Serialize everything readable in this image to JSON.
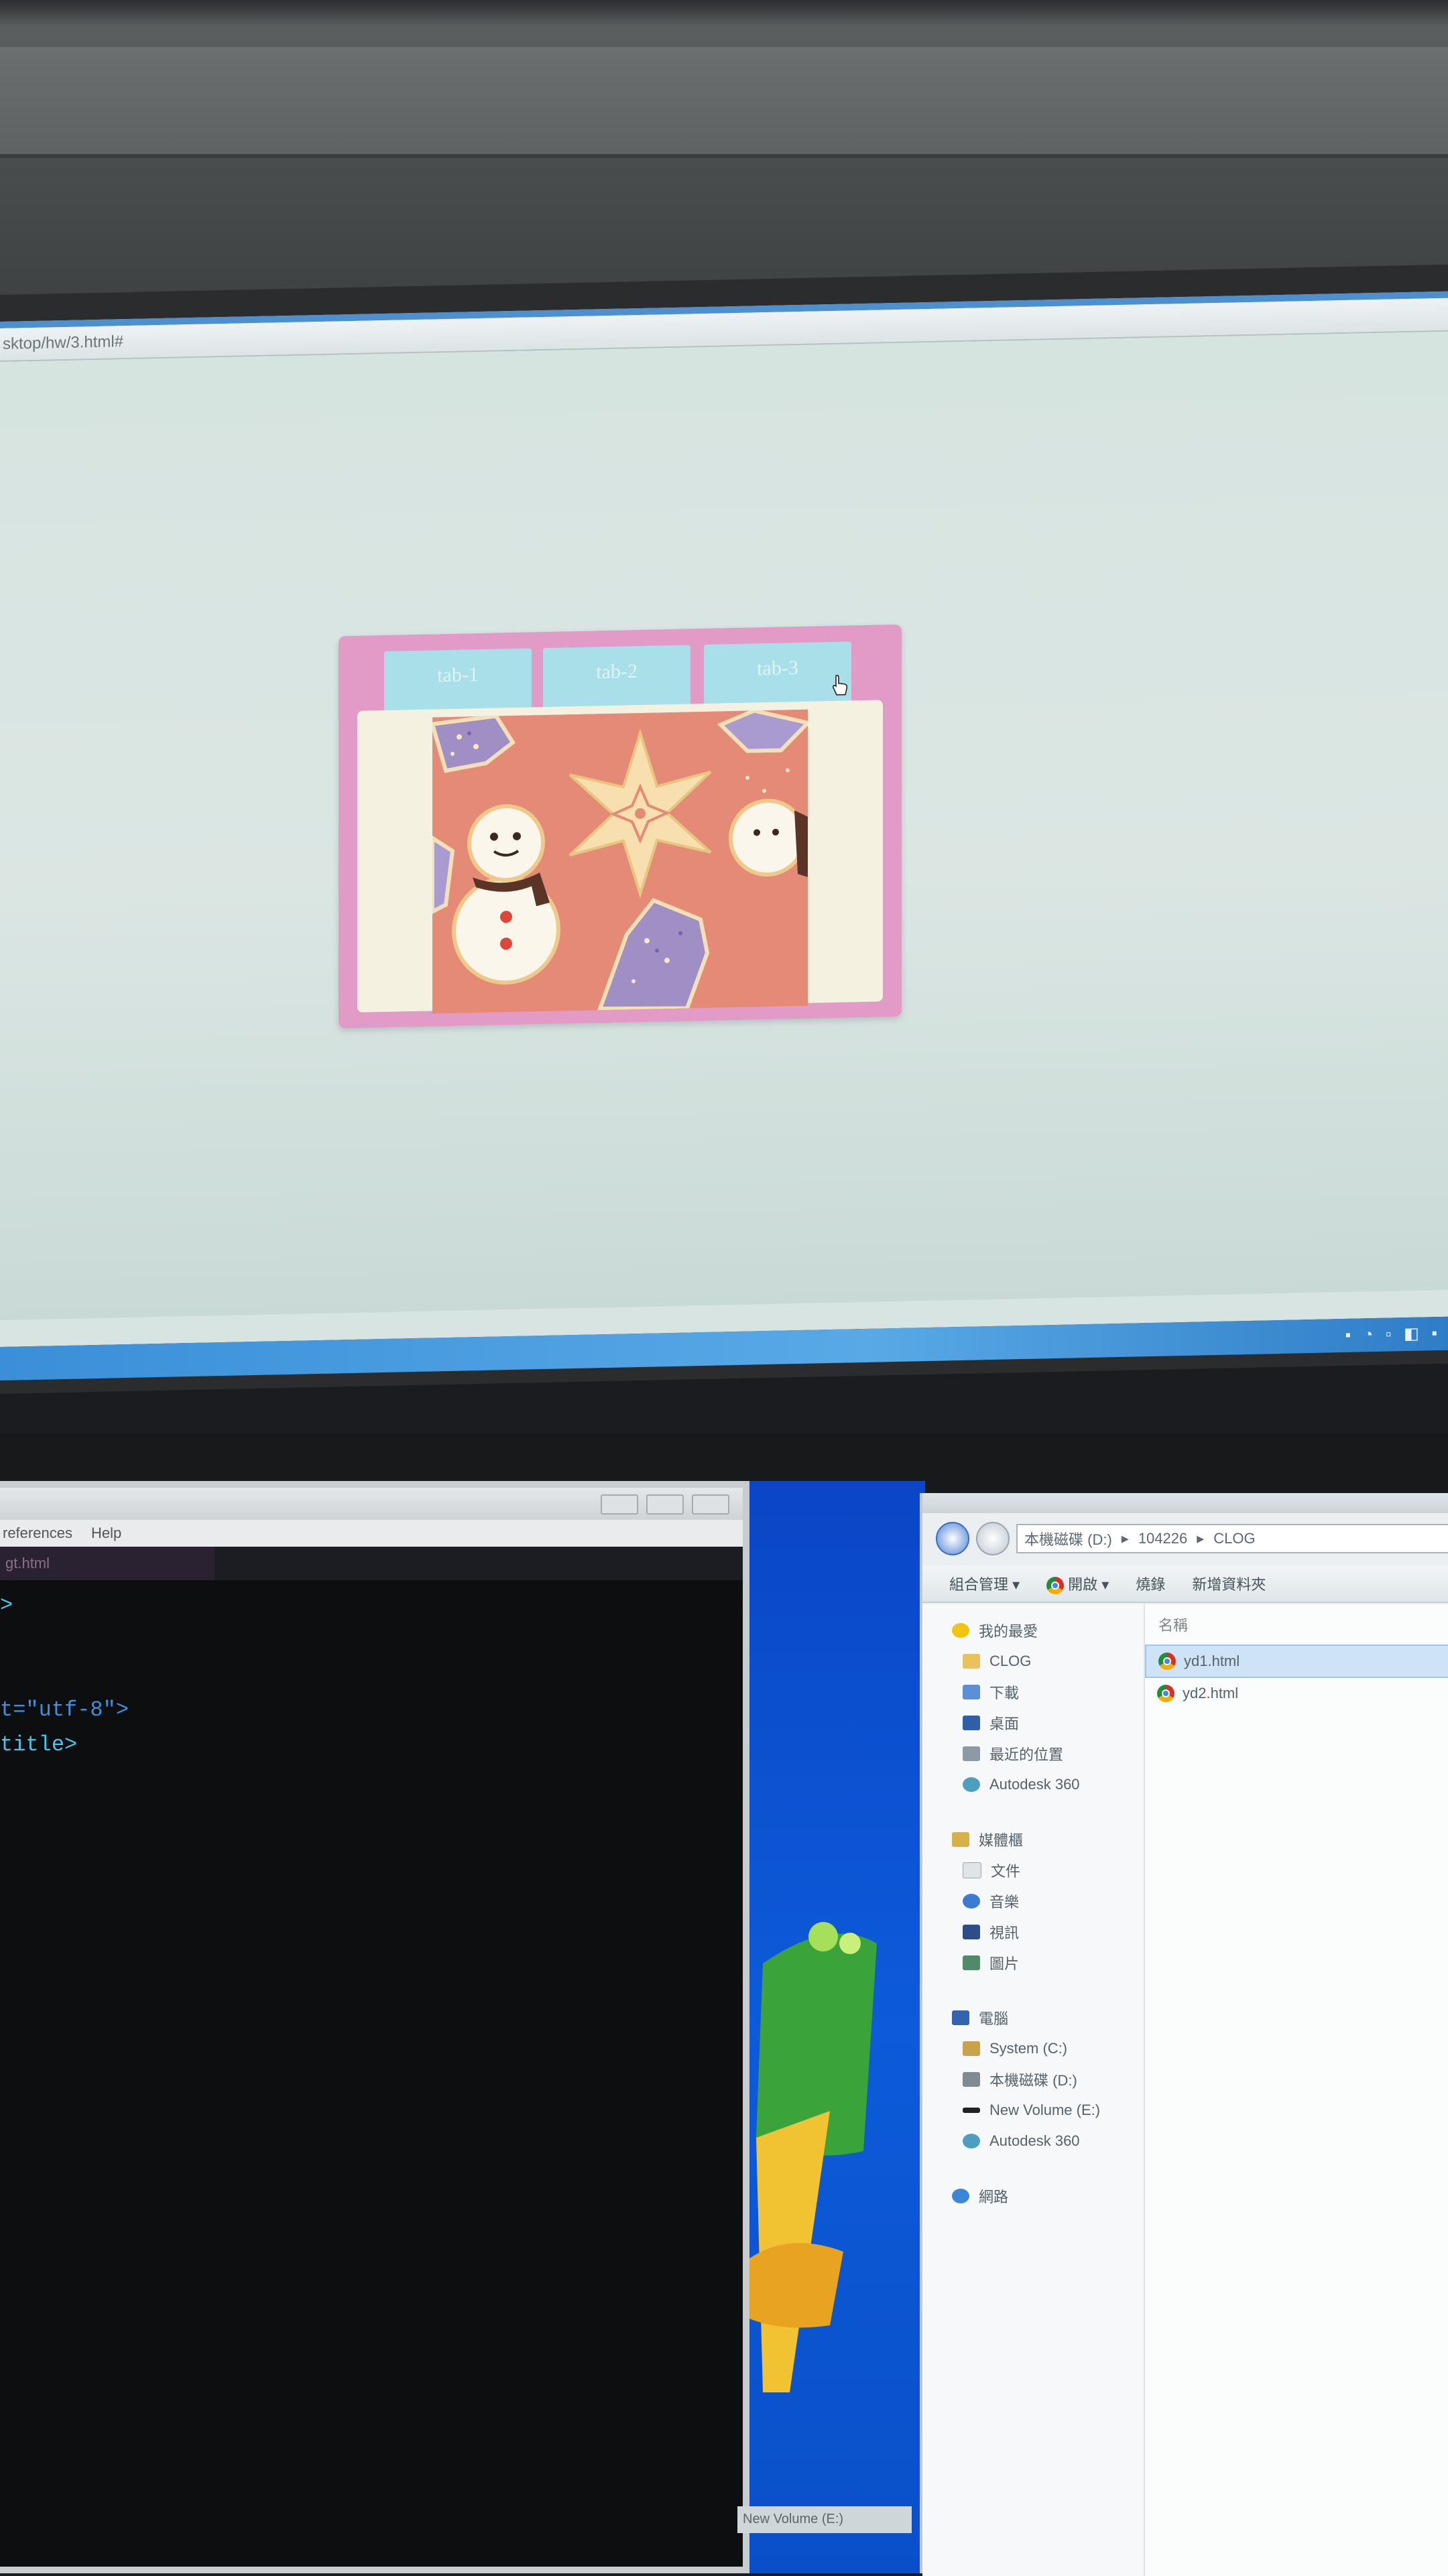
{
  "browser": {
    "address": "sktop/hw/3.html#",
    "tabs": [
      {
        "label": "tab-1"
      },
      {
        "label": "tab-2"
      },
      {
        "label": "tab-3"
      }
    ],
    "active_content": "cookie-illustration",
    "colors": {
      "widget_frame": "#e29bc7",
      "tab_bg": "#a8dfe8",
      "panel_bg": "#f4f1e1",
      "taskbar": "#3a8fd8"
    }
  },
  "editor": {
    "menu": [
      "references",
      "Help"
    ],
    "tab_label": "gt.html",
    "code_lines": [
      ">",
      "",
      "",
      "t=\"utf-8\">",
      "title>"
    ]
  },
  "explorer": {
    "address_parts": [
      "本機磁碟 (D:)",
      "104226",
      "CLOG"
    ],
    "toolbar": [
      "組合管理 ▾",
      "開啟 ▾",
      "燒錄",
      "新增資料夾"
    ],
    "nav_groups": [
      {
        "title": "我的最愛",
        "items": [
          "CLOG",
          "下載",
          "桌面",
          "最近的位置",
          "Autodesk 360"
        ]
      },
      {
        "title": "媒體櫃",
        "items": [
          "文件",
          "音樂",
          "視訊",
          "圖片"
        ]
      },
      {
        "title": "電腦",
        "items": [
          "System (C:)",
          "本機磁碟 (D:)",
          "New Volume (E:)",
          "Autodesk 360"
        ]
      },
      {
        "title": "網路",
        "items": []
      }
    ],
    "files_header": "名稱",
    "files": [
      {
        "name": "yd1.html",
        "selected": true
      },
      {
        "name": "yd2.html",
        "selected": false
      }
    ],
    "status": "New Volume (E:)"
  }
}
